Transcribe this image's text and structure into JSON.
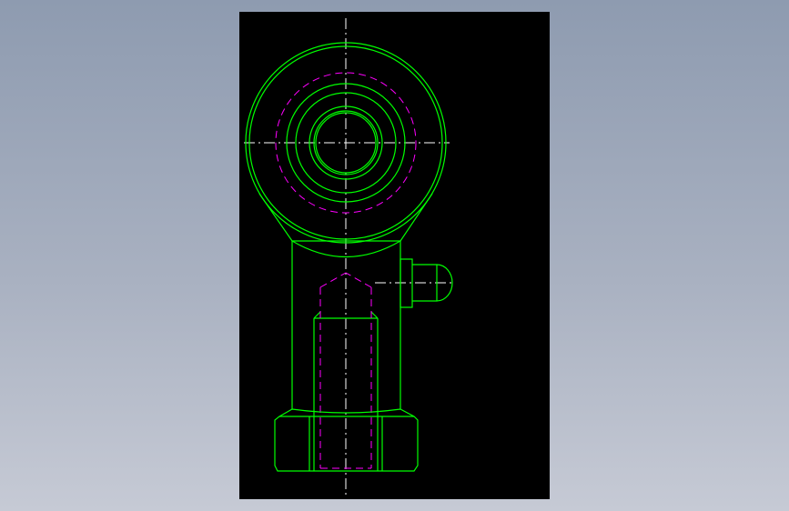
{
  "drawing": {
    "background_color": "#000000",
    "outline_color": "#00ff00",
    "hidden_line_color": "#ff00ff",
    "centerline_color": "#ffffff",
    "viewport_color": "#8e9bb0"
  }
}
